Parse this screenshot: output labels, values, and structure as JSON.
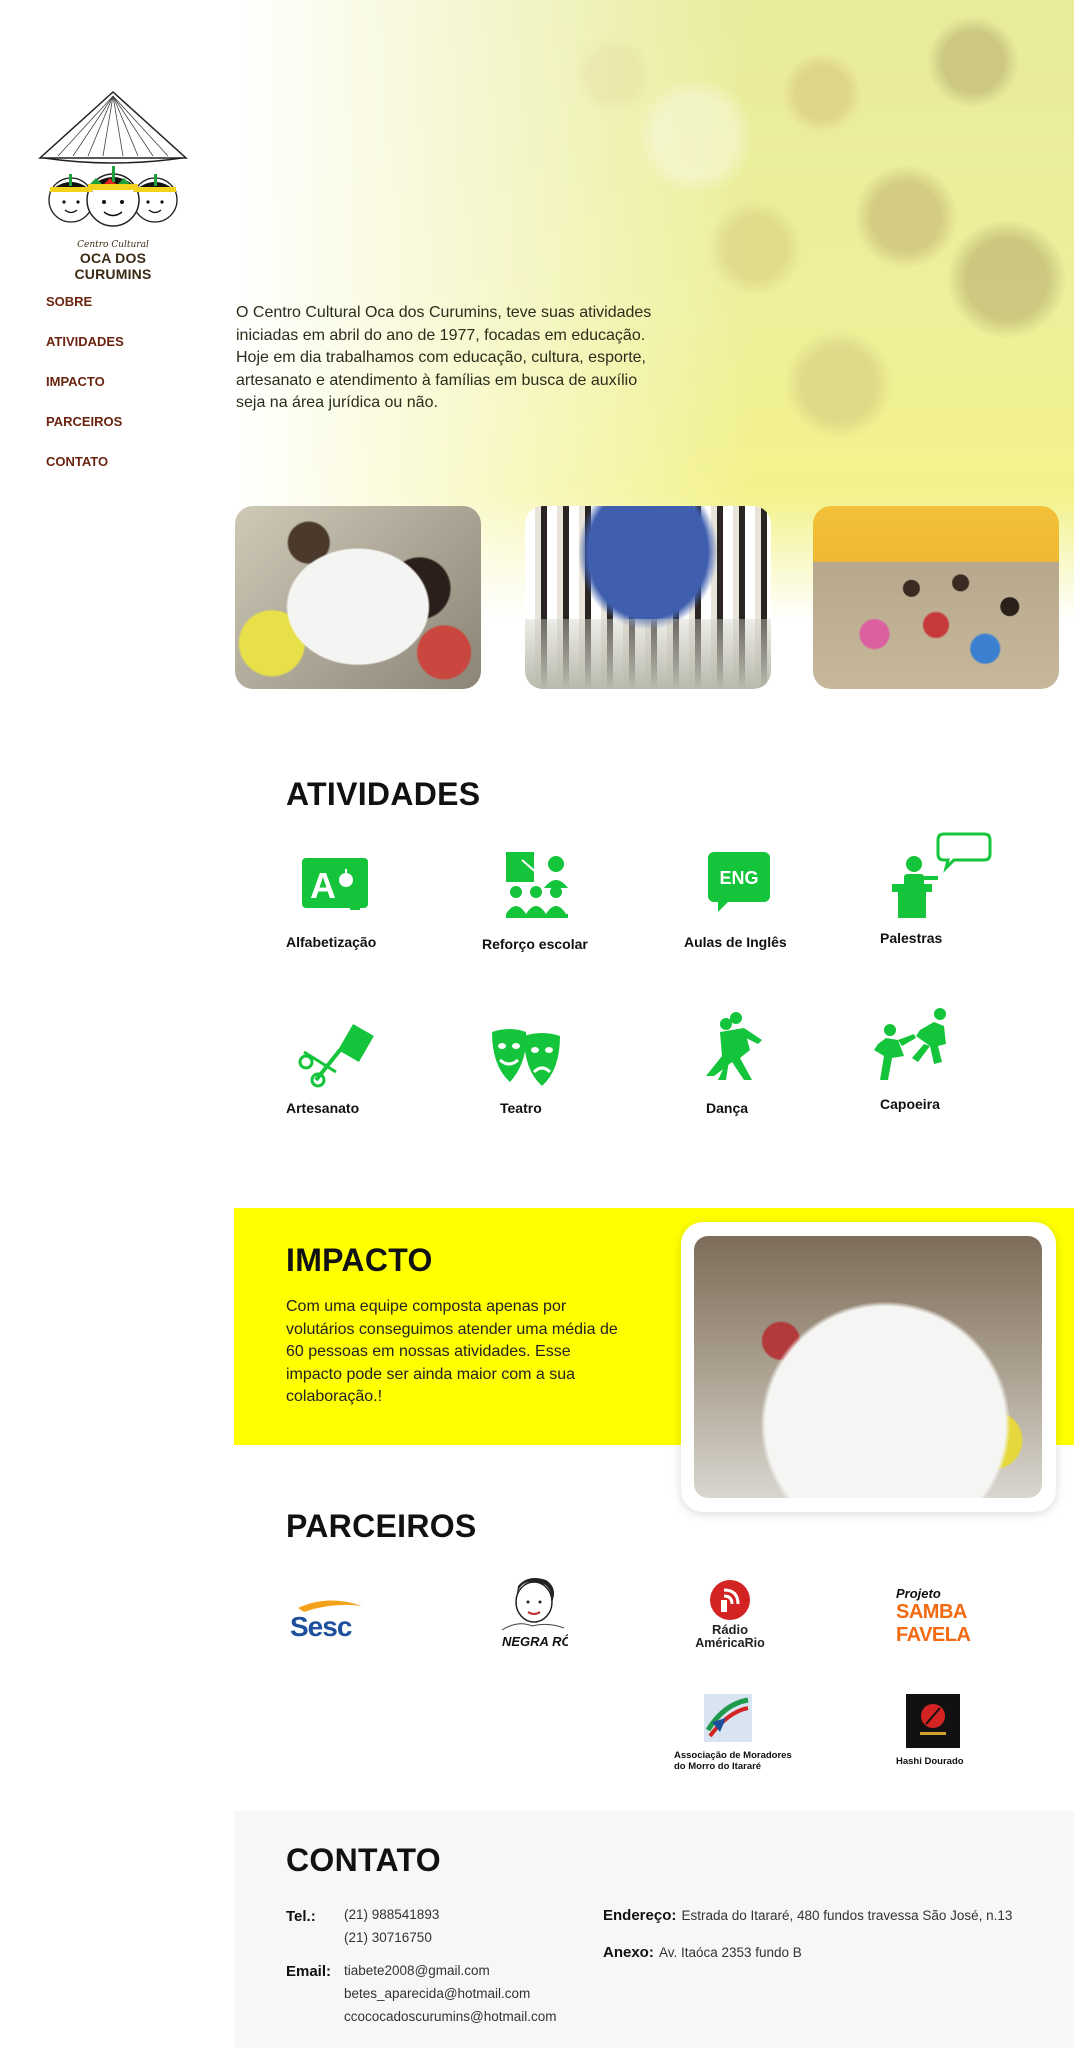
{
  "logo": {
    "subtitle": "Centro Cultural",
    "title": "OCA DOS CURUMINS"
  },
  "nav": {
    "items": [
      "SOBRE",
      "ATIVIDADES",
      "IMPACTO",
      "PARCEIROS",
      "CONTATO"
    ]
  },
  "intro": {
    "text": "O Centro Cultural Oca dos Curumins, teve suas atividades iniciadas em abril do ano de 1977, focadas em educação. Hoje em dia trabalhamos com educação, cultura, esporte, artesanato e atendimento à famílias em busca de auxílio seja na área jurídica ou não."
  },
  "atividades": {
    "title": "ATIVIDADES",
    "items": [
      {
        "label": "Alfabetização",
        "icon": "alphabet-icon"
      },
      {
        "label": "Reforço escolar",
        "icon": "classroom-icon"
      },
      {
        "label": "Aulas de Inglês",
        "icon": "english-chat-icon",
        "icon_text": "ENG"
      },
      {
        "label": "Palestras",
        "icon": "lecture-icon"
      },
      {
        "label": "Artesanato",
        "icon": "craft-icon"
      },
      {
        "label": "Teatro",
        "icon": "theater-masks-icon"
      },
      {
        "label": "Dança",
        "icon": "dance-icon"
      },
      {
        "label": "Capoeira",
        "icon": "capoeira-icon"
      }
    ],
    "icon_color": "#14c43a"
  },
  "impacto": {
    "title": "IMPACTO",
    "text": "Com uma equipe composta apenas por volutários conseguimos atender uma média de 60 pessoas em nossas atividades. Esse impacto pode ser ainda maior com a sua colaboração.!",
    "band_color": "#ffff00"
  },
  "parceiros": {
    "title": "PARCEIROS",
    "logos": [
      {
        "name": "Sesc",
        "text": "Sesc"
      },
      {
        "name": "Negra Ro",
        "text": "NEGRA RÔ"
      },
      {
        "name": "Rádio América Rio",
        "line1": "Rádio",
        "line2": "AméricaRio"
      },
      {
        "name": "Projeto Samba Favela",
        "line1": "Projeto",
        "line2": "SAMBA FAVELA"
      },
      {
        "name": "Associação de Moradores do Morro do Itararé",
        "line1": "Associação de Moradores",
        "line2": "do Morro do Itararé"
      },
      {
        "name": "Hashi Dourado",
        "text": "Hashi Dourado"
      }
    ]
  },
  "contato": {
    "title": "CONTATO",
    "tel_label": "Tel.:",
    "phones": [
      "(21) 988541893",
      "(21) 30716750"
    ],
    "email_label": "Email:",
    "emails": [
      "tiabete2008@gmail.com",
      "betes_aparecida@hotmail.com",
      "ccococadoscurumins@hotmail.com"
    ],
    "endereco_label": "Endereço:",
    "endereco": "Estrada do Itararé, 480 fundos travessa São José, n.13",
    "anexo_label": "Anexo:",
    "anexo": "Av. Itaóca 2353 fundo B"
  },
  "colors": {
    "accent_green": "#14c43a",
    "nav_brown": "#6b2410",
    "yellow": "#ffff00"
  }
}
